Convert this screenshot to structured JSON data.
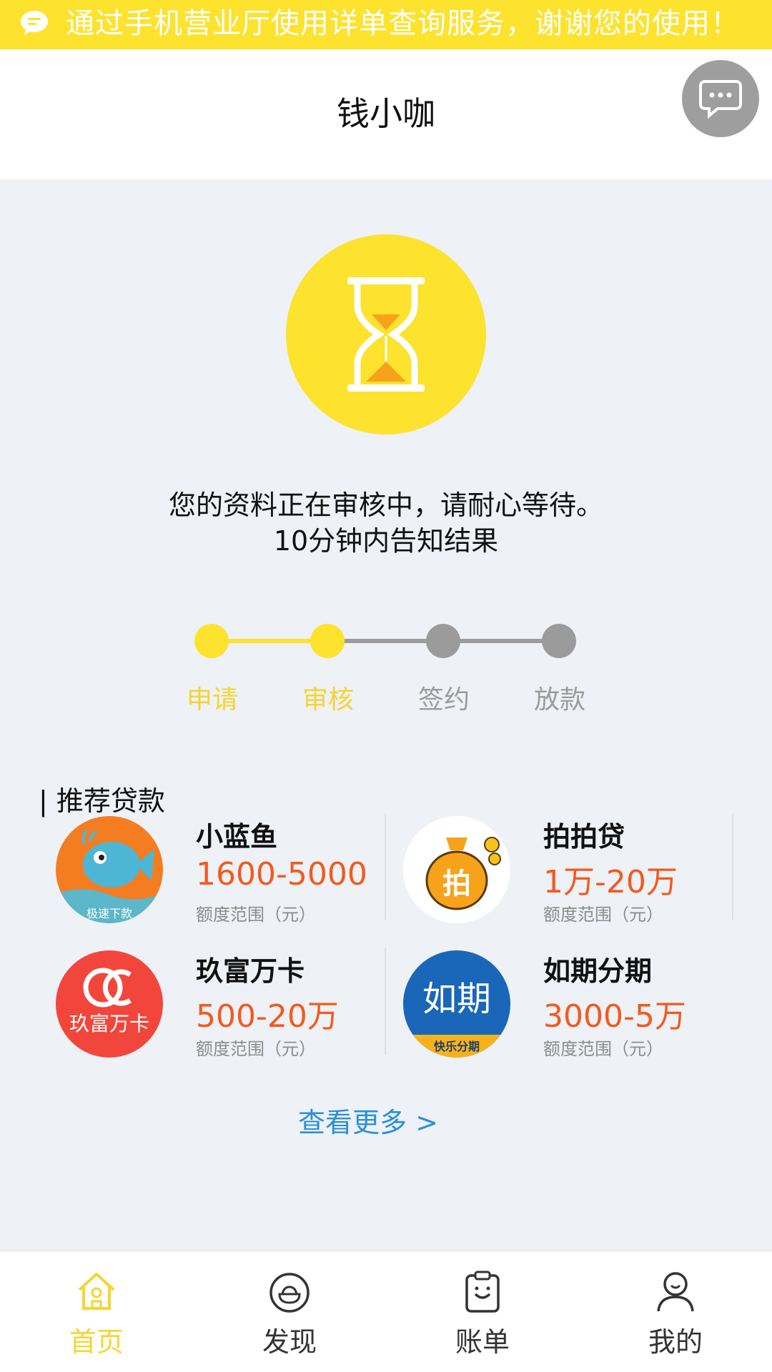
{
  "marquee": {
    "text": "通过手机营业厅使用详单查询服务，谢谢您的使用！"
  },
  "header": {
    "title": "钱小咖"
  },
  "status": {
    "line1": "您的资料正在审核中，请耐心等待。",
    "line2": "10分钟内告知结果"
  },
  "steps": [
    {
      "label": "申请",
      "active": true
    },
    {
      "label": "审核",
      "active": true
    },
    {
      "label": "签约",
      "active": false
    },
    {
      "label": "放款",
      "active": false
    }
  ],
  "recommend": {
    "title": "| 推荐贷款",
    "loans": [
      {
        "name": "小蓝鱼",
        "range": "1600-5000",
        "sub": "额度范围（元）",
        "logo_text": "极速下款"
      },
      {
        "name": "拍拍贷",
        "range": "1万-20万",
        "sub": "额度范围（元）",
        "logo_text": "拍"
      },
      {
        "name": "玖富万卡",
        "range": "500-20万",
        "sub": "额度范围（元）",
        "logo_text": "玖富万卡"
      },
      {
        "name": "如期分期",
        "range": "3000-5万",
        "sub": "额度范围（元）",
        "logo_text": "如期",
        "logo_sub": "快乐分期"
      }
    ],
    "more": "查看更多 >"
  },
  "tabs": [
    {
      "label": "首页",
      "icon": "home-icon",
      "active": true
    },
    {
      "label": "发现",
      "icon": "discover-icon",
      "active": false
    },
    {
      "label": "账单",
      "icon": "bill-icon",
      "active": false
    },
    {
      "label": "我的",
      "icon": "user-icon",
      "active": false
    }
  ],
  "colors": {
    "accent": "#fde22e",
    "active_text": "#f5d531",
    "inactive": "#9b9b9b",
    "range": "#f25a1f",
    "link": "#2a8fd8"
  }
}
